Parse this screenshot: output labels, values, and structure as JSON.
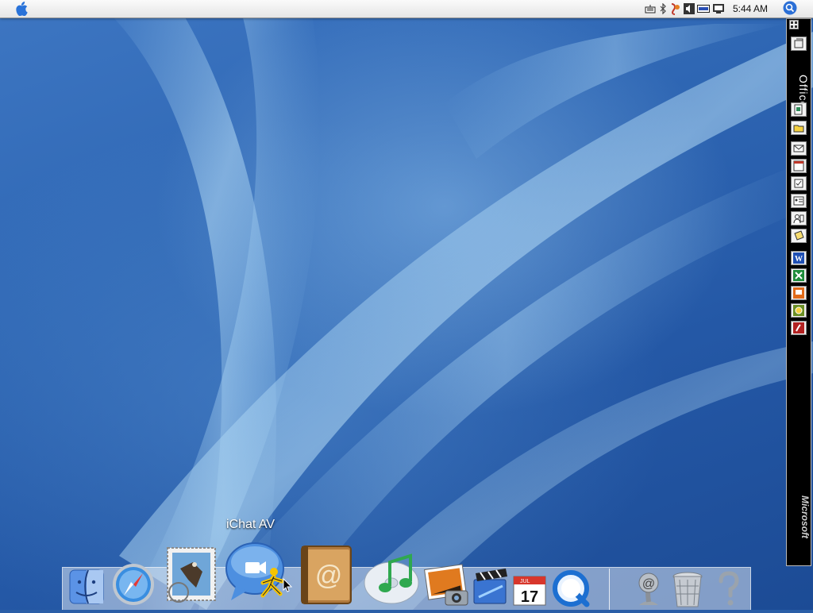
{
  "menubar": {
    "apple_menu": "apple-icon",
    "status_items": [
      "keyboard-icon",
      "bluetooth-icon",
      "script-icon",
      "volume-icon",
      "battery-icon",
      "display-icon"
    ],
    "clock": "5:44 AM",
    "spotlight": "spotlight-icon"
  },
  "office_toolbar": {
    "label": "Office",
    "brand": "Microsoft",
    "buttons": [
      "new-document",
      "open-document",
      "mail",
      "calendar",
      "task",
      "contact",
      "address-book",
      "note",
      "word",
      "excel",
      "powerpoint",
      "entourage",
      "acrobat"
    ]
  },
  "dock": {
    "tooltip": "iChat AV",
    "apps": [
      "Finder",
      "Safari",
      "Mail",
      "iChat AV",
      "Address Book",
      "iTunes",
      "iPhoto",
      "iMovie",
      "iCal",
      "QuickTime Player",
      "Mail Server",
      "Trash",
      "Help"
    ],
    "ical_date": "17",
    "ical_month": "JUL",
    "mail_at": "@"
  },
  "colors": {
    "desktop_blue": "#2f67b4",
    "dock_bg": "#d7e1f0",
    "office_bar": "#000000"
  }
}
